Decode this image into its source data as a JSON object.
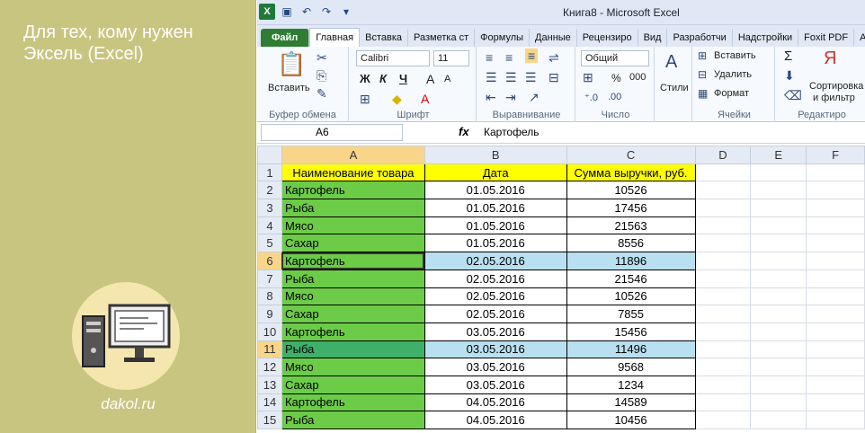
{
  "promo": {
    "headline": "Для тех, кому нужен Эксель (Excel)",
    "site": "dakol.ru"
  },
  "window": {
    "title": "Книга8 - Microsoft Excel"
  },
  "tabs": [
    "Файл",
    "Главная",
    "Вставка",
    "Разметка ст",
    "Формулы",
    "Данные",
    "Рецензиро",
    "Вид",
    "Разработчи",
    "Надстройки",
    "Foxit PDF",
    "AB"
  ],
  "ribbon": {
    "clipboard": {
      "paste": "Вставить",
      "label": "Буфер обмена"
    },
    "font": {
      "name": "Calibri",
      "size": "11",
      "bold": "Ж",
      "italic": "К",
      "underline": "Ч",
      "grow": "A",
      "shrink": "A",
      "label": "Шрифт"
    },
    "alignment": {
      "label": "Выравнивание"
    },
    "number": {
      "format": "Общий",
      "percent": "%",
      "thousands": "000",
      "label": "Число"
    },
    "styles": {
      "label": "Стили"
    },
    "cells": {
      "insert": "Вставить",
      "delete": "Удалить",
      "format": "Формат",
      "label": "Ячейки"
    },
    "editing": {
      "sigma": "Σ",
      "sort": "Сортировка",
      "filter": "и фильтр",
      "label": "Редактиро"
    }
  },
  "formula_bar": {
    "cell_ref": "A6",
    "fx": "fx",
    "value": "Картофель"
  },
  "columns": [
    "A",
    "B",
    "C",
    "D",
    "E",
    "F"
  ],
  "header_row": [
    "Наименование товара",
    "Дата",
    "Сумма выручки, руб."
  ],
  "rows": [
    [
      "Картофель",
      "01.05.2016",
      "10526"
    ],
    [
      "Рыба",
      "01.05.2016",
      "17456"
    ],
    [
      "Мясо",
      "01.05.2016",
      "21563"
    ],
    [
      "Сахар",
      "01.05.2016",
      "8556"
    ],
    [
      "Картофель",
      "02.05.2016",
      "11896"
    ],
    [
      "Рыба",
      "02.05.2016",
      "21546"
    ],
    [
      "Мясо",
      "02.05.2016",
      "10526"
    ],
    [
      "Сахар",
      "02.05.2016",
      "7855"
    ],
    [
      "Картофель",
      "03.05.2016",
      "15456"
    ],
    [
      "Рыба",
      "03.05.2016",
      "11496"
    ],
    [
      "Мясо",
      "03.05.2016",
      "9568"
    ],
    [
      "Сахар",
      "03.05.2016",
      "1234"
    ],
    [
      "Картофель",
      "04.05.2016",
      "14589"
    ],
    [
      "Рыба",
      "04.05.2016",
      "10456"
    ]
  ],
  "colors": {
    "name_fill": "#6ccc48",
    "header_fill": "#ffff00",
    "highlight_fill": "#b9e0f0",
    "file_tab": "#2e7d32"
  }
}
